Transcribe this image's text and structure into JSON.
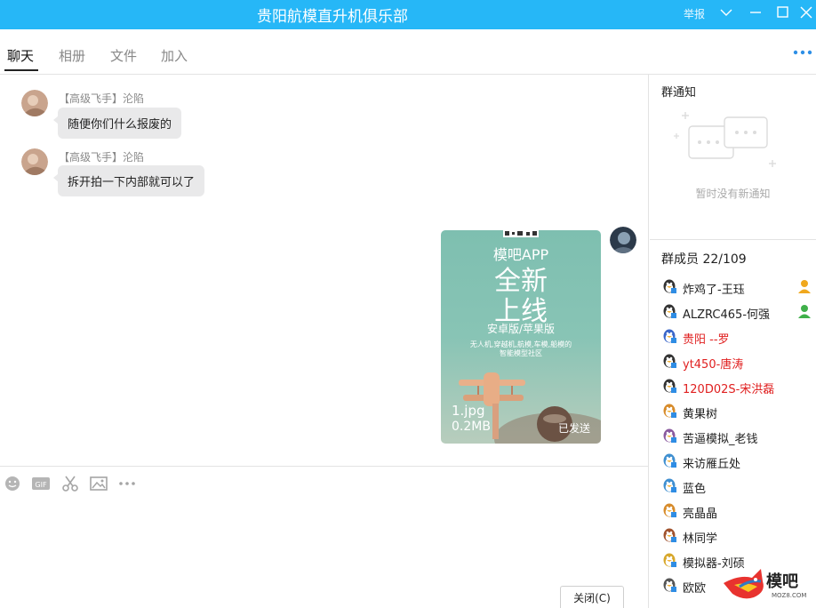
{
  "window": {
    "title": "贵阳航模直升机俱乐部",
    "report_label": "举报"
  },
  "tabs": [
    {
      "label": "聊天",
      "active": true
    },
    {
      "label": "相册",
      "active": false
    },
    {
      "label": "文件",
      "active": false
    },
    {
      "label": "加入",
      "active": false
    }
  ],
  "messages": [
    {
      "sender": "【高级飞手】沦陷",
      "text": "随便你们什么报废的"
    },
    {
      "sender": "【高级飞手】沦陷",
      "text": "拆开拍一下内部就可以了"
    }
  ],
  "image_message": {
    "headline_small": "模吧APP",
    "headline_big_1": "全新",
    "headline_big_2": "上线",
    "platforms": "安卓版/苹果版",
    "tagline_1": "无人机,穿越机,航模,车模,船模的",
    "tagline_2": "智能模型社区",
    "file_name": "1.jpg",
    "file_size": "0.2MB",
    "status": "已发送"
  },
  "notice": {
    "title": "群通知",
    "empty_text": "暂时没有新通知"
  },
  "members": {
    "title": "群成员 22/109",
    "list": [
      {
        "name": "炸鸡了-王珏",
        "red": false,
        "role": "owner"
      },
      {
        "name": " ALZRC465-何强",
        "red": false,
        "role": "admin"
      },
      {
        "name": "贵阳 --罗",
        "red": true,
        "role": ""
      },
      {
        "name": "yt450-唐涛",
        "red": true,
        "role": ""
      },
      {
        "name": "120D02S-宋洪磊",
        "red": true,
        "role": ""
      },
      {
        "name": "黄果树",
        "red": false,
        "role": ""
      },
      {
        "name": "苦逼模拟_老钱",
        "red": false,
        "role": ""
      },
      {
        "name": "来访雁丘处",
        "red": false,
        "role": ""
      },
      {
        "name": "蓝色",
        "red": false,
        "role": ""
      },
      {
        "name": "亮晶晶",
        "red": false,
        "role": ""
      },
      {
        "name": "林同学",
        "red": false,
        "role": ""
      },
      {
        "name": "模拟器-刘硕",
        "red": false,
        "role": ""
      },
      {
        "name": "欧欧",
        "red": false,
        "role": ""
      }
    ]
  },
  "input": {
    "close_label": "关闭(C)"
  },
  "logo": {
    "text": "模吧",
    "sub": "MOZ8.COM"
  },
  "colors": {
    "titlebar": "#26b7f7",
    "red_name": "#e02020",
    "bubble": "#e9e9ea"
  }
}
